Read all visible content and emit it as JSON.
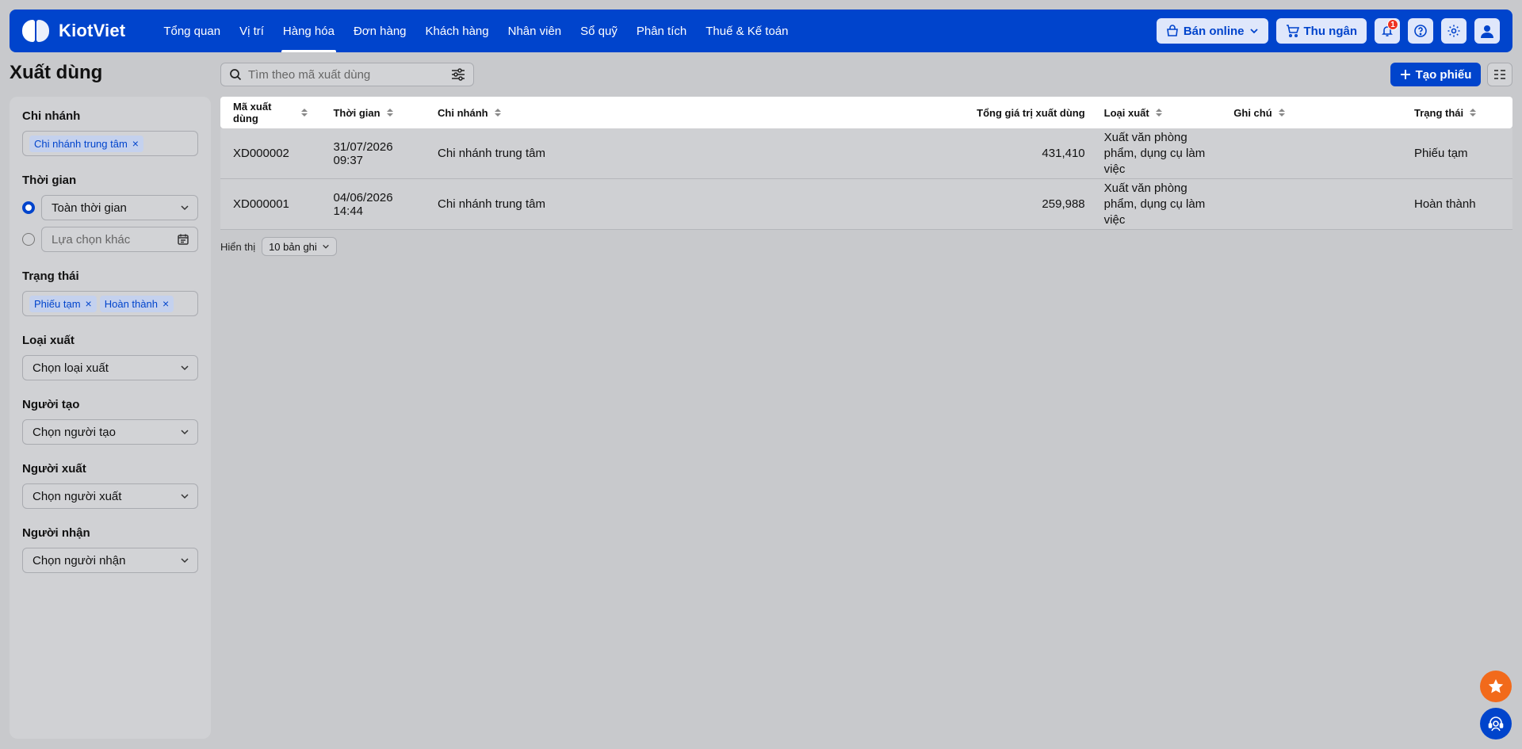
{
  "brand": {
    "name": "KiotViet"
  },
  "nav": {
    "items": [
      "Tổng quan",
      "Vị trí",
      "Hàng hóa",
      "Đơn hàng",
      "Khách hàng",
      "Nhân viên",
      "Sổ quỹ",
      "Phân tích",
      "Thuế & Kế toán"
    ],
    "active": "Hàng hóa",
    "online_label": "Bán online",
    "cashier_label": "Thu ngân",
    "notification_count": "1"
  },
  "page": {
    "title": "Xuất dùng"
  },
  "filters": {
    "branch": {
      "label": "Chi nhánh",
      "tags": [
        "Chi nhánh trung tâm"
      ]
    },
    "time": {
      "label": "Thời gian",
      "preset": "Toàn thời gian",
      "custom_placeholder": "Lựa chọn khác"
    },
    "status": {
      "label": "Trạng thái",
      "tags": [
        "Phiếu tạm",
        "Hoàn thành"
      ]
    },
    "type": {
      "label": "Loại xuất",
      "placeholder": "Chọn loại xuất"
    },
    "creator": {
      "label": "Người tạo",
      "placeholder": "Chọn người tạo"
    },
    "issuer": {
      "label": "Người xuất",
      "placeholder": "Chọn người xuất"
    },
    "receiver": {
      "label": "Người nhận",
      "placeholder": "Chọn người nhận"
    }
  },
  "toolbar": {
    "search_placeholder": "Tìm theo mã xuất dùng",
    "create_label": "Tạo phiếu"
  },
  "table": {
    "columns": [
      "Mã xuất dùng",
      "Thời gian",
      "Chi nhánh",
      "Tổng giá trị xuất dùng",
      "Loại xuất",
      "Ghi chú",
      "Trạng thái"
    ],
    "rows": [
      {
        "code": "XD000002",
        "time": "31/07/2026 09:37",
        "branch": "Chi nhánh trung tâm",
        "total": "431,410",
        "type": "Xuất văn phòng phẩm, dụng cụ làm việc",
        "note": "",
        "status": "Phiếu tạm"
      },
      {
        "code": "XD000001",
        "time": "04/06/2026 14:44",
        "branch": "Chi nhánh trung tâm",
        "total": "259,988",
        "type": "Xuất văn phòng phẩm, dụng cụ làm việc",
        "note": "",
        "status": "Hoàn thành"
      }
    ]
  },
  "pager": {
    "label": "Hiển thị",
    "page_size": "10 bản ghi"
  },
  "colors": {
    "primary": "#0044cc",
    "accent": "#f26a1b"
  }
}
